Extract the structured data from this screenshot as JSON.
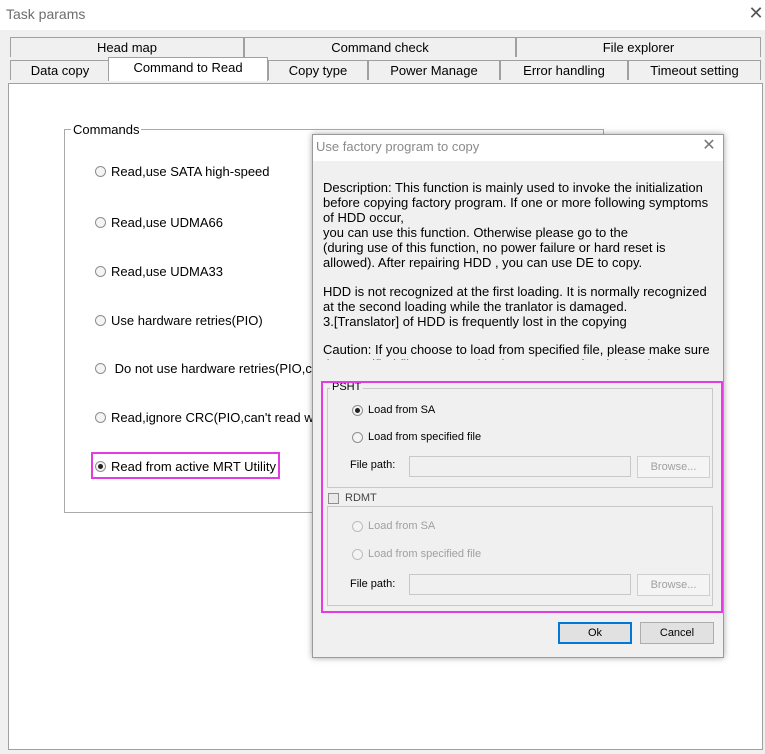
{
  "window": {
    "title": "Task params",
    "close_icon": "close-icon"
  },
  "tabs": {
    "row1": [
      "Head map",
      "Command check",
      "File explorer"
    ],
    "row2": [
      "Data copy",
      "Command to Read",
      "Copy type",
      "Power Manage",
      "Error handling",
      "Timeout setting"
    ],
    "active": "Command to Read"
  },
  "commands": {
    "legend": "Commands",
    "options": [
      {
        "label": "Read,use SATA high-speed",
        "selected": false
      },
      {
        "label": "Read,use UDMA66",
        "selected": false
      },
      {
        "label": "Read,use UDMA33",
        "selected": false
      },
      {
        "label": "Use hardware retries(PIO)",
        "selected": false
      },
      {
        "label": " Do not use hardware retries(PIO,c",
        "selected": false
      },
      {
        "label": "Read,ignore CRC(PIO,can't read wh",
        "selected": false
      },
      {
        "label": "Read from active MRT Utility",
        "selected": true
      }
    ]
  },
  "dialog": {
    "title": "Use factory program to copy",
    "description": [
      "Description: This function is mainly used to invoke the initialization before copying factory program. If one or more following symptoms of HDD occur,",
      "you can use this function. Otherwise please go to the",
      "(during use of this function, no power failure or hard reset is allowed). After repairing HDD , you can use DE to copy.",
      "",
      "HDD is not recognized at the first loading. It is normally recognized at the second loading while the tranlator is damaged.",
      "3.[Translator] of HDD is frequently lost in the copying",
      "",
      "Caution: If you choose to load from specified file, please make sure the specified file not moved in the process. After the hard reset or powering down of the"
    ],
    "psht": {
      "legend": "PSHT",
      "load_from_sa": "Load from SA",
      "load_from_file": "Load from specified file",
      "file_path_label": "File path:",
      "file_path_value": "",
      "browse": "Browse..."
    },
    "rdmt": {
      "legend": "RDMT",
      "checked": false,
      "load_from_sa": "Load from SA",
      "load_from_file": "Load from specified file",
      "file_path_label": "File path:",
      "file_path_value": "",
      "browse": "Browse..."
    },
    "ok": "Ok",
    "cancel": "Cancel"
  },
  "colors": {
    "highlight": "#e23ce2",
    "default_button_border": "#0078d7"
  }
}
